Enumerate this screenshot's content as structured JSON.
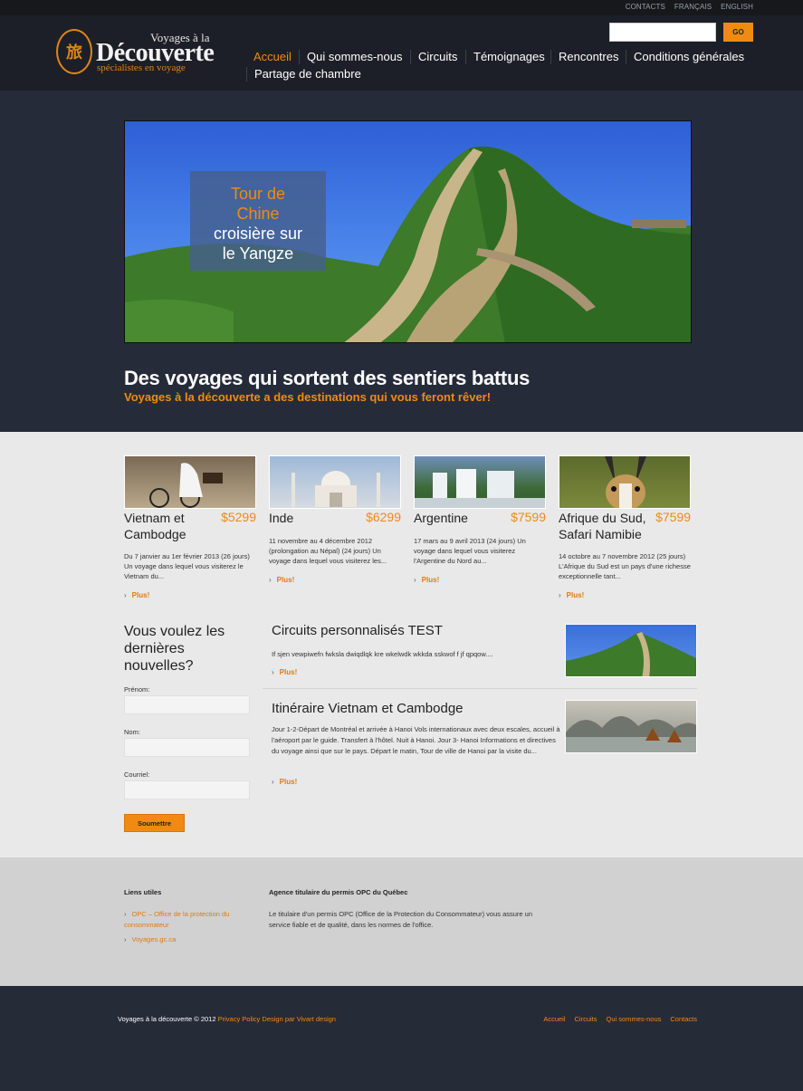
{
  "topbar": {
    "links": [
      "CONTACTS",
      "FRANÇAIS",
      "ENGLISH"
    ]
  },
  "logo": {
    "line1": "Voyages à la",
    "line2": "Découverte",
    "line3": "spécialistes en voyage"
  },
  "search": {
    "value": "",
    "button": "GO"
  },
  "nav": {
    "items": [
      "Accueil",
      "Qui sommes-nous",
      "Circuits",
      "Témoignages",
      "Rencontres",
      "Conditions générales",
      "Partage de chambre"
    ]
  },
  "hero": {
    "caption_line1": "Tour de",
    "caption_line2": "Chine",
    "caption_line3": "croisière sur",
    "caption_line4": "le Yangze",
    "tagline": "Des voyages qui sortent des sentiers battus",
    "subtag": "Voyages à la découverte a des destinations qui vous feront rêver!"
  },
  "tours": [
    {
      "name": "Vietnam et Cambodge",
      "price": "$5299",
      "desc": "Du 7 janvier au 1er février 2013 (26 jours)  Un voyage dans lequel vous visiterez le Vietnam du...",
      "more": "Plus!"
    },
    {
      "name": "Inde",
      "price": "$6299",
      "desc": "11 novembre au 4 décembre 2012 (prolongation au Népal) (24 jours) Un voyage dans lequel vous visiterez les...",
      "more": "Plus!"
    },
    {
      "name": "Argentine",
      "price": "$7599",
      "desc": "17 mars au 9 avril 2013 (24 jours) Un voyage dans lequel vous visiterez l'Argentine du Nord au...",
      "more": "Plus!"
    },
    {
      "name": "Afrique du Sud, Safari Namibie",
      "price": "$7599",
      "desc": "14 octobre au 7 novembre 2012 (25 jours) L'Afrique du Sud est un pays d'une richesse exceptionnelle tant...",
      "more": "Plus!"
    }
  ],
  "newsletter": {
    "title": "Vous voulez les dernières nouvelles?",
    "first_name_label": "Prénom:",
    "last_name_label": "Nom:",
    "email_label": "Courriel:",
    "submit": "Soumettre"
  },
  "posts": [
    {
      "title": "Circuits personnalisés TEST",
      "desc": "If sjen vewpiwefn fwksla dwiqdlqk  kre wkelwdk wkkda sskwof f jf qpqow....",
      "more": "Plus!"
    },
    {
      "title": "Itinéraire Vietnam et Cambodge",
      "desc": "Jour 1-2-Départ de Montréal et arrivée à Hanoi Vols internationaux avec deux escales, accueil à l'aéroport par le guide. Transfert à l'hôtel. Nuit à Hanoi. Jour 3- Hanoi Informations et directives du voyage ainsi que sur le pays. Départ le matin, Tour de ville de Hanoi par la visite du...",
      "more": "Plus!"
    }
  ],
  "footer": {
    "useful_title": "Liens utiles",
    "useful_links": [
      "OPC – Office de la protection du consommateur",
      "Voyages.gc.ca"
    ],
    "agency_title": "Agence titulaire du permis OPC du Québec",
    "agency_text": "Le titulaire d'un permis OPC (Office de la Protection du Consommateur) vous assure un service fiable et de qualité, dans les normes de l'office.",
    "copyright": "Voyages à la découverte © 2012",
    "privacy": "Privacy Policy",
    "design": "Design par Vivart design",
    "nav": [
      "Accueil",
      "Circuits",
      "Qui sommes-nous",
      "Contacts"
    ]
  }
}
